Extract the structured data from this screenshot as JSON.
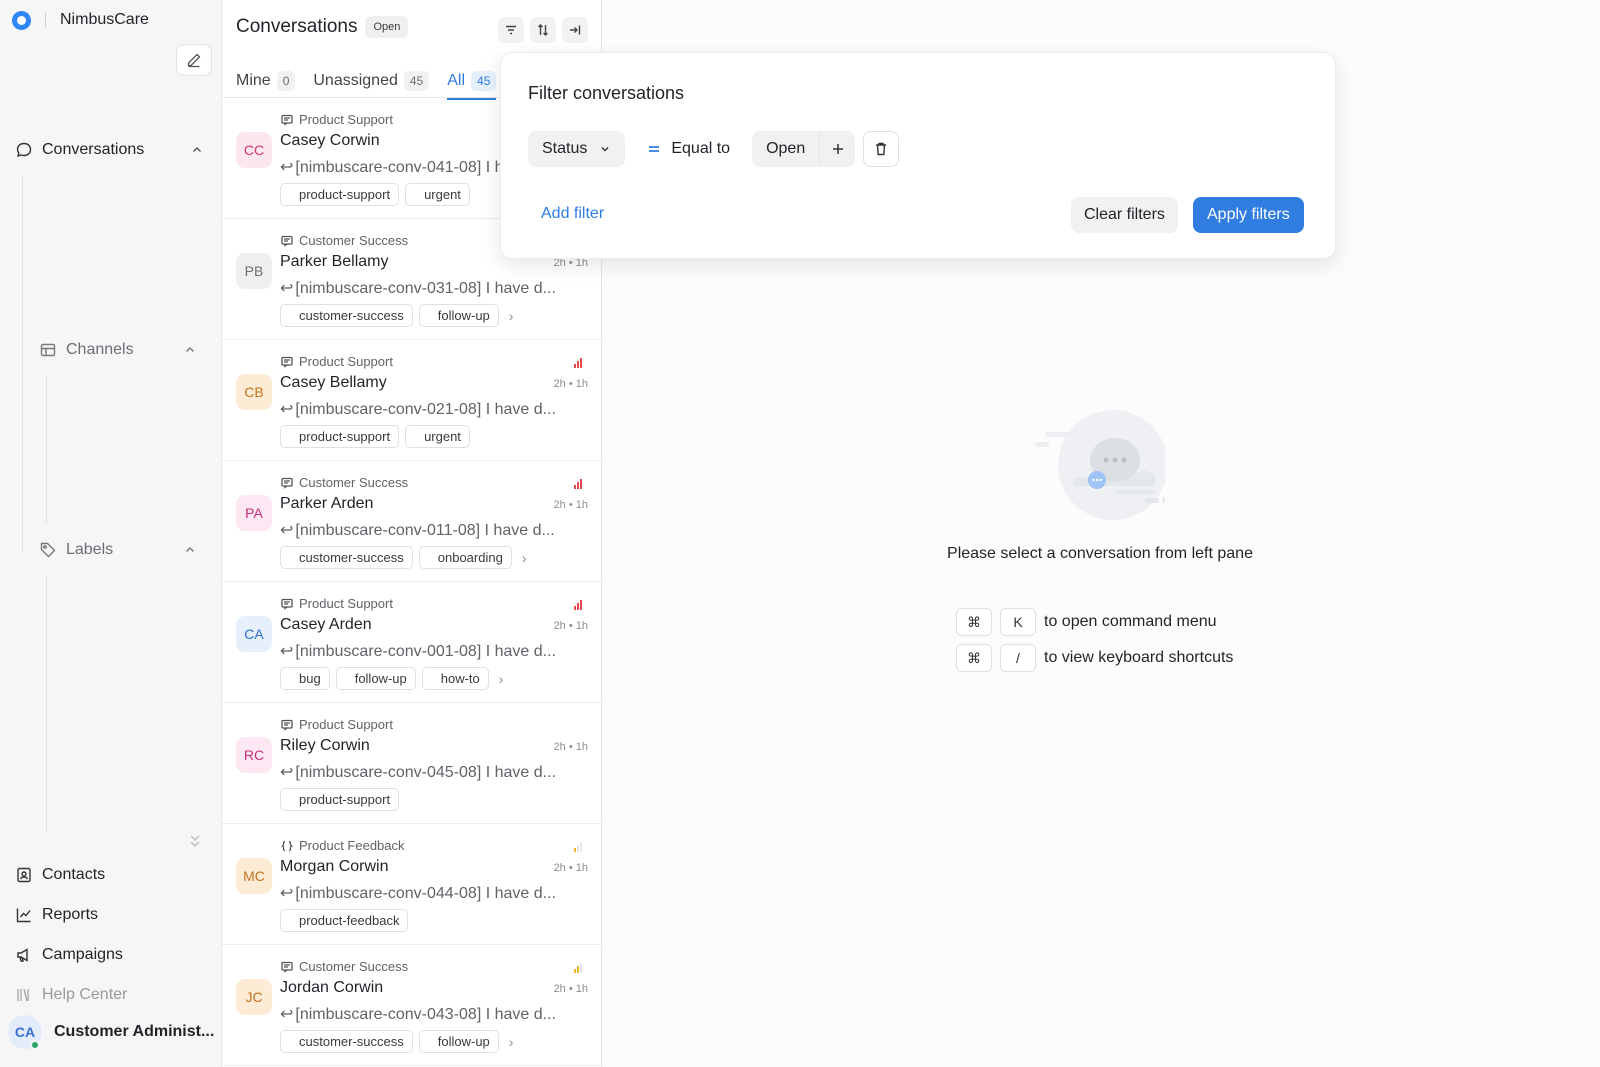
{
  "app": {
    "name": "NimbusCare"
  },
  "sidebar": {
    "conversations": "Conversations",
    "channels": "Channels",
    "labels": "Labels",
    "bottom": [
      {
        "label": "Contacts",
        "icon": "contacts-icon"
      },
      {
        "label": "Reports",
        "icon": "reports-icon"
      },
      {
        "label": "Campaigns",
        "icon": "campaigns-icon"
      },
      {
        "label": "Help Center",
        "icon": "help-center-icon"
      }
    ],
    "user": {
      "initials": "CA",
      "name": "Customer Administ..."
    }
  },
  "list": {
    "title": "Conversations",
    "status": "Open",
    "tabs": [
      {
        "label": "Mine",
        "count": "0"
      },
      {
        "label": "Unassigned",
        "count": "45"
      },
      {
        "label": "All",
        "count": "45"
      }
    ],
    "conversations": [
      {
        "initials": "CC",
        "inbox": "Product Support",
        "name": "Casey Corwin",
        "time": "",
        "preview": "[nimbuscare-conv-041-08] I have d...",
        "labels": [
          "product-support",
          "urgent"
        ],
        "more": false,
        "priority": ""
      },
      {
        "initials": "PB",
        "inbox": "Customer Success",
        "name": "Parker Bellamy",
        "time": "2h • 1h",
        "preview": "[nimbuscare-conv-031-08] I have d...",
        "labels": [
          "customer-success",
          "follow-up"
        ],
        "more": true,
        "priority": ""
      },
      {
        "initials": "CB",
        "inbox": "Product Support",
        "name": "Casey Bellamy",
        "time": "2h • 1h",
        "preview": "[nimbuscare-conv-021-08] I have d...",
        "labels": [
          "product-support",
          "urgent"
        ],
        "more": false,
        "priority": "urgent"
      },
      {
        "initials": "PA",
        "inbox": "Customer Success",
        "name": "Parker Arden",
        "time": "2h • 1h",
        "preview": "[nimbuscare-conv-011-08] I have d...",
        "labels": [
          "customer-success",
          "onboarding"
        ],
        "more": true,
        "priority": "urgent"
      },
      {
        "initials": "CA",
        "inbox": "Product Support",
        "name": "Casey Arden",
        "time": "2h • 1h",
        "preview": "[nimbuscare-conv-001-08] I have d...",
        "labels": [
          "bug",
          "follow-up",
          "how-to"
        ],
        "more": true,
        "priority": "urgent"
      },
      {
        "initials": "RC",
        "inbox": "Product Support",
        "name": "Riley Corwin",
        "time": "2h • 1h",
        "preview": "[nimbuscare-conv-045-08] I have d...",
        "labels": [
          "product-support"
        ],
        "more": false,
        "priority": ""
      },
      {
        "initials": "MC",
        "inbox": "Product Feedback",
        "name": "Morgan Corwin",
        "time": "2h • 1h",
        "preview": "[nimbuscare-conv-044-08] I have d...",
        "labels": [
          "product-feedback"
        ],
        "more": false,
        "priority": "low"
      },
      {
        "initials": "JC",
        "inbox": "Customer Success",
        "name": "Jordan Corwin",
        "time": "2h • 1h",
        "preview": "[nimbuscare-conv-043-08] I have d...",
        "labels": [
          "customer-success",
          "follow-up"
        ],
        "more": true,
        "priority": "medium"
      }
    ]
  },
  "filter": {
    "title": "Filter conversations",
    "attribute": "Status",
    "operator": "Equal to",
    "value": "Open",
    "add_filter": "Add filter",
    "clear": "Clear filters",
    "apply": "Apply filters"
  },
  "empty": {
    "message": "Please select a conversation from left pane",
    "shortcuts": [
      {
        "keys": [
          "⌘",
          "K"
        ],
        "text": "to open command menu"
      },
      {
        "keys": [
          "⌘",
          "/"
        ],
        "text": "to view keyboard shortcuts"
      }
    ]
  },
  "colors": {
    "accent": "#2f7de1",
    "avatar_palette": {
      "CC": [
        "#fde7ef",
        "#d6336c"
      ],
      "PB": [
        "#efefef",
        "#6b6f76"
      ],
      "CB": [
        "#fdebd6",
        "#c2731b"
      ],
      "PA": [
        "#fde7f2",
        "#c2307a"
      ],
      "CA": [
        "#e6f0fd",
        "#2f6fc4"
      ],
      "RC": [
        "#fde7f2",
        "#c2307a"
      ],
      "MC": [
        "#fdebd6",
        "#c2731b"
      ],
      "JC": [
        "#fdebd6",
        "#c2731b"
      ]
    }
  }
}
